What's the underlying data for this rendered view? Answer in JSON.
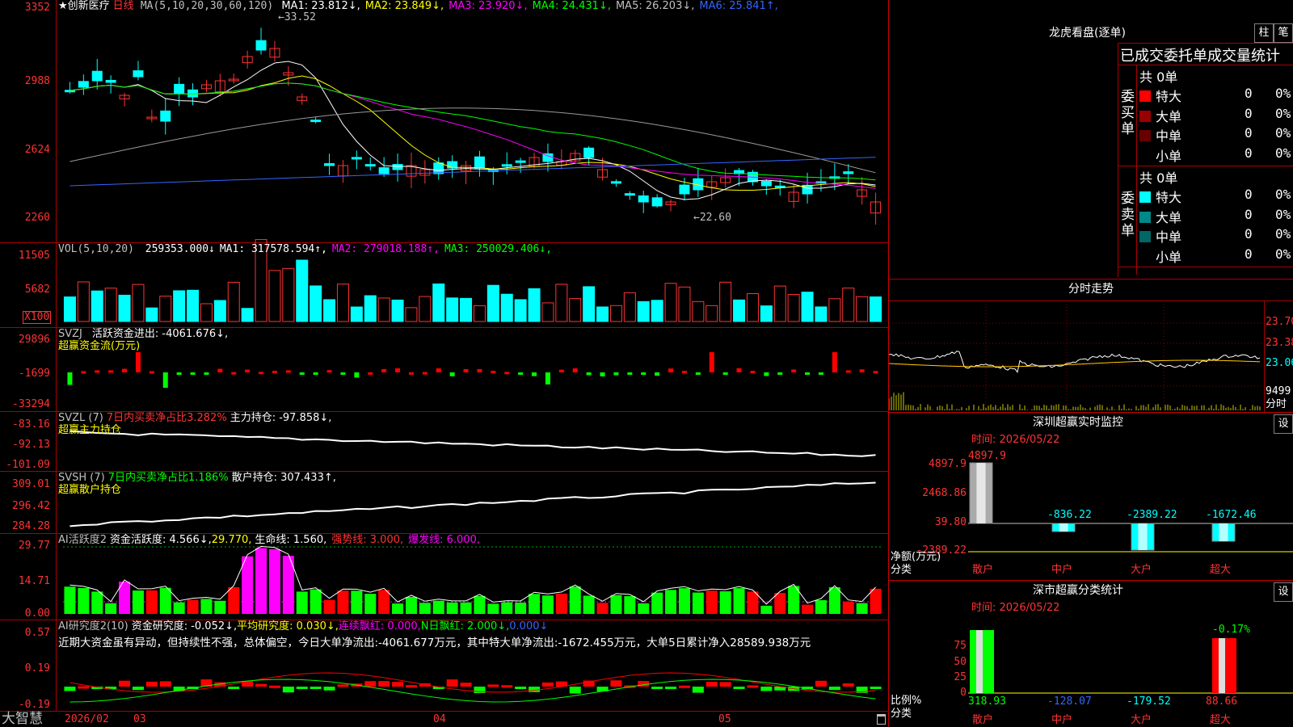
{
  "kline": {
    "title": "创新医疗",
    "period": "日线",
    "ma_header": "MA(5,10,20,30,60,120)",
    "ma": [
      {
        "label": "MA1: 23.812↓",
        "color": "#ffffff"
      },
      {
        "label": "MA2: 23.849↓",
        "color": "#ffff00"
      },
      {
        "label": "MA3: 23.920↓",
        "color": "#ff00ff"
      },
      {
        "label": "MA4: 24.431↓",
        "color": "#00ff00"
      },
      {
        "label": "MA5: 26.203↓",
        "color": "#c0c0c0"
      },
      {
        "label": "MA6: 25.841↑",
        "color": "#3366ff"
      }
    ],
    "axis": [
      "3352",
      "2988",
      "2624",
      "2260"
    ],
    "high_mark": "33.52",
    "low_mark": "22.60"
  },
  "vol": {
    "header": "VOL(5,10,20)",
    "value": "259353.000↓",
    "ma": [
      {
        "label": "MA1: 317578.594↑",
        "color": "#ffffff"
      },
      {
        "label": "MA2: 279018.188↑",
        "color": "#ff00ff"
      },
      {
        "label": "MA3: 250029.406↓",
        "color": "#00ff00"
      }
    ],
    "axis": [
      "11505",
      "5682"
    ],
    "unit": "X100"
  },
  "svzj": {
    "header": "SVZJ",
    "label": "活跃资金进出: -4061.676↓,",
    "title": "超赢资金流(万元)",
    "axis": [
      "29896",
      "-1699",
      "-33294"
    ]
  },
  "svzl": {
    "header": "SVZL (7)",
    "ratio": "7日内买卖净占比3.282%",
    "label": "主力持仓: -97.858↓,",
    "title": "超赢主力持仓",
    "axis": [
      "-83.16",
      "-92.13",
      "-101.09"
    ]
  },
  "svsh": {
    "header": "SVSH (7)",
    "ratio": "7日内买卖净占比1.186%",
    "label": "散户持仓: 307.433↑,",
    "title": "超赢散户持仓",
    "axis": [
      "309.01",
      "296.42",
      "284.28"
    ]
  },
  "ai1": {
    "header": "AI活跃度2",
    "a": "资金活跃度: 4.566↓,",
    "b": "29.770,",
    "c": "生命线: 1.560,",
    "d": "强势线: 3.000,",
    "e": "爆发线: 6.000,",
    "axis": [
      "29.77",
      "14.71",
      "0.00"
    ]
  },
  "ai2": {
    "header": "AI研究度2(10)",
    "a": "资金研究度: -0.052↓,",
    "b": "平均研究度: 0.030↓,",
    "c": "连续飘红: 0.000,",
    "d": "N日飘红: 2.000↓,",
    "e": "0.000↓",
    "comment": "近期大资金虽有异动，但持续性不强，总体偏空，今日大单净流出:-4061.677万元，其中特大单净流出:-1672.455万元，大单5日累计净入28589.938万元",
    "axis": [
      "0.57",
      "0.19",
      "-0.19"
    ]
  },
  "bottom": {
    "brand": "大智慧",
    "dates": [
      "2026/02",
      "03",
      "04",
      "05"
    ]
  },
  "lhkp": {
    "title": "龙虎看盘(逐单)",
    "btn1": "柱",
    "btn2": "笔",
    "subtitle": "已成交委托单成交量统计",
    "buy_label": "委买单",
    "sell_label": "委卖单",
    "buy_total": "共 0单",
    "sell_total": "共 0单",
    "buy_rows": [
      {
        "name": "特大",
        "count": "0",
        "pct": "0%",
        "color": "#ff0000"
      },
      {
        "name": "大单",
        "count": "0",
        "pct": "0%",
        "color": "#990000"
      },
      {
        "name": "中单",
        "count": "0",
        "pct": "0%",
        "color": "#660000"
      },
      {
        "name": "小单",
        "count": "0",
        "pct": "0%",
        "color": "#000000"
      }
    ],
    "sell_rows": [
      {
        "name": "特大",
        "count": "0",
        "pct": "0%",
        "color": "#00ffff"
      },
      {
        "name": "大单",
        "count": "0",
        "pct": "0%",
        "color": "#008888"
      },
      {
        "name": "中单",
        "count": "0",
        "pct": "0%",
        "color": "#006666"
      },
      {
        "name": "小单",
        "count": "0",
        "pct": "0%",
        "color": "#000000"
      }
    ]
  },
  "fenshi": {
    "title": "分时走势",
    "axis": [
      "23.70",
      "23.38",
      "23.06"
    ],
    "vol": "9499",
    "unit": "分时"
  },
  "szcy": {
    "title": "深圳超赢实时监控",
    "btn": "设",
    "time": "时间: 2026/05/22",
    "axis": [
      "4897.9",
      "2468.86",
      "39.80",
      "-2389.22"
    ],
    "ylabel": "净额(万元)",
    "xlabel": "分类",
    "bars": [
      {
        "name": "散户",
        "value": "4897.9"
      },
      {
        "name": "中户",
        "value": "-836.22"
      },
      {
        "name": "大户",
        "value": "-2389.22"
      },
      {
        "name": "超大",
        "value": "-1672.46"
      }
    ]
  },
  "sscy": {
    "title": "深市超赢分类统计",
    "btn": "设",
    "time": "时间: 2026/05/22",
    "axis": [
      "75",
      "50",
      "25",
      "0"
    ],
    "ylabel": "比例%",
    "xlabel": "分类",
    "top_label": "-0.17%",
    "bars": [
      {
        "name": "散户",
        "value": "318.93"
      },
      {
        "name": "中户",
        "value": "-128.07"
      },
      {
        "name": "大户",
        "value": "-179.52"
      },
      {
        "name": "超大",
        "value": "88.66"
      }
    ]
  }
}
